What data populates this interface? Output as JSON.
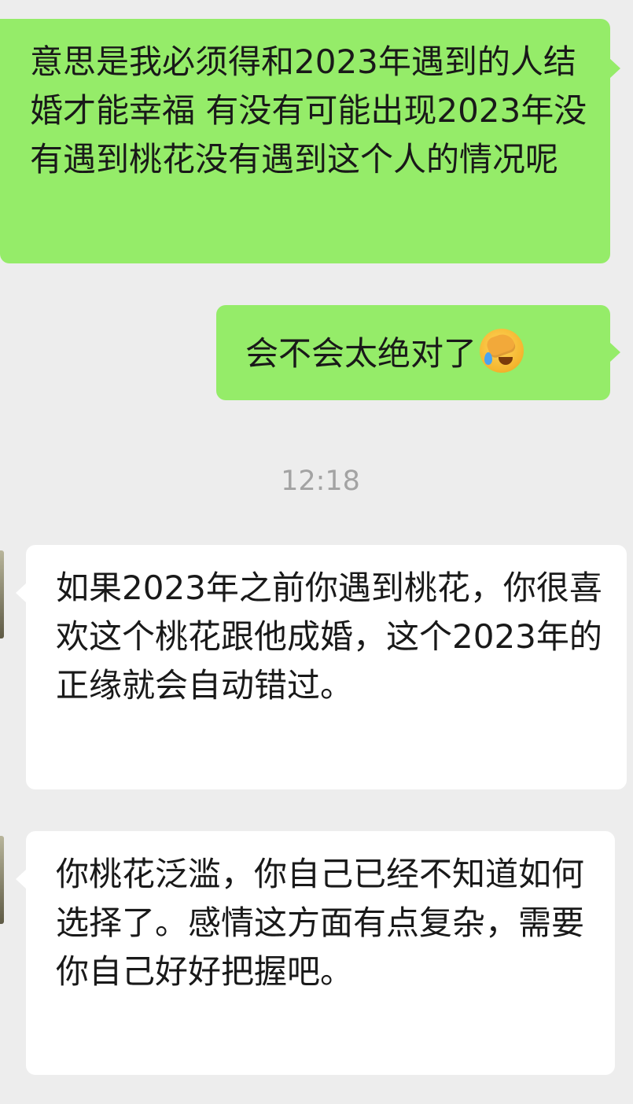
{
  "chat": {
    "messages": [
      {
        "direction": "sent",
        "text": "意思是我必须得和2023年遇到的人结婚才能幸福  有没有可能出现2023年没有遇到桃花没有遇到这个人的情况呢"
      },
      {
        "direction": "sent",
        "text": "会不会太绝对了",
        "emoji": "face-palm-laughing-emoji"
      },
      {
        "direction": "received",
        "text": "如果2023年之前你遇到桃花，你很喜欢这个桃花跟他成婚，这个2023年的正缘就会自动错过。"
      },
      {
        "direction": "received",
        "text": "你桃花泛滥，你自己已经不知道如何选择了。感情这方面有点复杂，需要你自己好好把握吧。"
      }
    ],
    "timestamp": "12:18"
  },
  "colors": {
    "background": "#ededed",
    "sent_bubble": "#95ec69",
    "received_bubble": "#ffffff",
    "text": "#191919",
    "timestamp": "#a3a3a3"
  }
}
